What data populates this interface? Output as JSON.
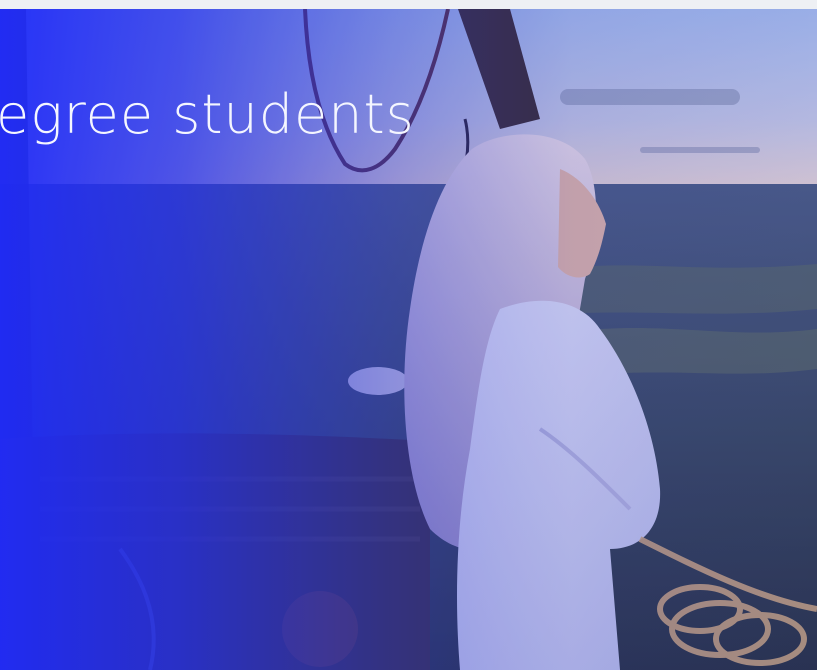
{
  "hero": {
    "headline": "egree students",
    "colors": {
      "overlay_blue": "#1f2bff",
      "sky_light": "#9fb7e8",
      "horizon_glow": "#f6d7c3",
      "jacket": "#e9eaf6",
      "hair": "#e8d3d8"
    }
  }
}
